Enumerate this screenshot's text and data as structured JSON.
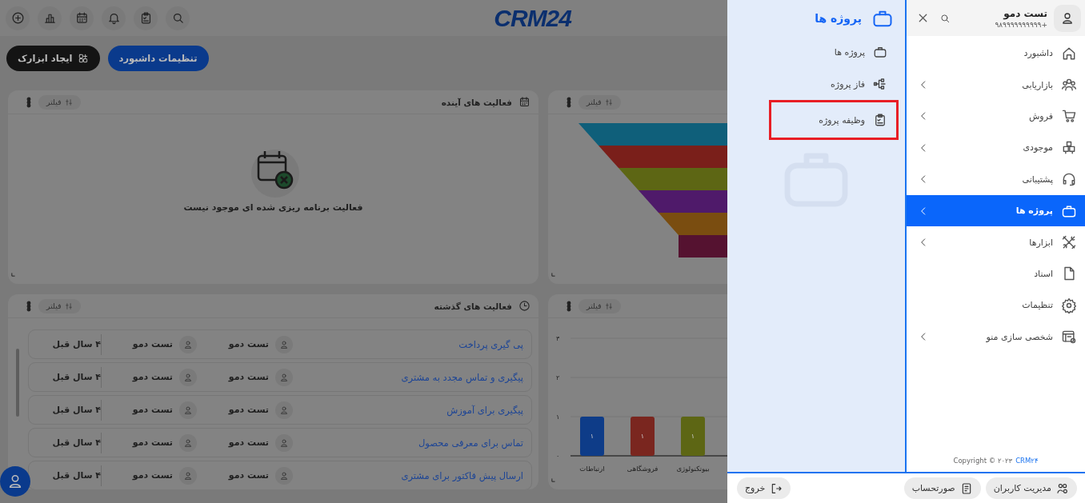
{
  "top_bar": {
    "logo": "CRM24"
  },
  "toolbar": {
    "buttons": [
      {
        "label": "تنظیمات داشبورد",
        "kind": "primary"
      },
      {
        "label": "ایجاد ابزارک",
        "kind": "dark"
      }
    ]
  },
  "widgets": [
    {
      "kind": "funnel",
      "filter": "فیلتر"
    },
    {
      "kind": "empty",
      "title": "فعالیت های آینده",
      "filter": "فیلتر",
      "message": "فعالیت برنامه ریزی شده ای موجود نیست"
    },
    {
      "kind": "bar_chart",
      "filter": "فیلتر",
      "chart_data": {
        "type": "bar",
        "categories": [
          "ارتباطات",
          "فروشگاهی",
          "بیوتکنولوژی"
        ],
        "series": [
          {
            "colors": [
              "#0e3c88",
              "#7a261f",
              "#5d6614"
            ],
            "values": [
              1,
              1,
              1
            ]
          }
        ],
        "ylim": [
          0,
          3
        ],
        "yticks": [
          {
            "value": 0,
            "label": "۰"
          },
          {
            "value": 1,
            "label": "۱"
          },
          {
            "value": 2,
            "label": "۲"
          },
          {
            "value": 3,
            "label": "۳"
          }
        ],
        "value_labels": [
          "۱",
          "۱",
          "۱"
        ]
      }
    },
    {
      "kind": "list",
      "title": "فعالیت های گذشته",
      "filter": "فیلتر",
      "rows": [
        {
          "title": "پی گیری پرداخت",
          "person_1": "تست دمو",
          "person_2": "تست دمو",
          "time": "۴ سال قبل"
        },
        {
          "title": "پیگیری و تماس مجدد به مشتری",
          "person_1": "تست دمو",
          "person_2": "تست دمو",
          "time": "۴ سال قبل"
        },
        {
          "title": "پیگیری برای آموزش",
          "person_1": "تست دمو",
          "person_2": "تست دمو",
          "time": "۴ سال قبل"
        },
        {
          "title": "تماس برای معرفی محصول",
          "person_1": "تست دمو",
          "person_2": "تست دمو",
          "time": "۴ سال قبل"
        },
        {
          "title": "ارسال پیش فاکتور برای مشتری",
          "person_1": "تست دمو",
          "person_2": "تست دمو",
          "time": "۴ سال قبل"
        }
      ]
    }
  ],
  "submenu": {
    "title": "پروژه ها",
    "items": [
      {
        "label": "پروژه ها",
        "highlighted": false
      },
      {
        "label": "فاز پروژه",
        "highlighted": false
      },
      {
        "label": "وظیفه پروژه",
        "highlighted": true
      }
    ]
  },
  "sidebar": {
    "user": {
      "name": "تست دمو",
      "phone": "۹۸۹۹۹۹۹۹۹۹۹۹+"
    },
    "items": [
      {
        "label": "داشبورد",
        "has_children": false,
        "selected": false
      },
      {
        "label": "بازاریابی",
        "has_children": true,
        "selected": false
      },
      {
        "label": "فروش",
        "has_children": true,
        "selected": false
      },
      {
        "label": "موجودی",
        "has_children": true,
        "selected": false
      },
      {
        "label": "پشتیبانی",
        "has_children": true,
        "selected": false
      },
      {
        "label": "پروژه ها",
        "has_children": true,
        "selected": true
      },
      {
        "label": "ابزارها",
        "has_children": true,
        "selected": false
      },
      {
        "label": "اسناد",
        "has_children": false,
        "selected": false
      },
      {
        "label": "تنظیمات",
        "has_children": false,
        "selected": false
      },
      {
        "label": "شخصی سازی منو",
        "has_children": true,
        "selected": false
      }
    ],
    "copyright": "Copyright © ۲۰۲۳",
    "copyright_link": "CRM۲۴"
  },
  "footer": {
    "left_button": "خروج",
    "right_buttons": [
      "مدیریت کاربران",
      "صورتحساب"
    ]
  }
}
